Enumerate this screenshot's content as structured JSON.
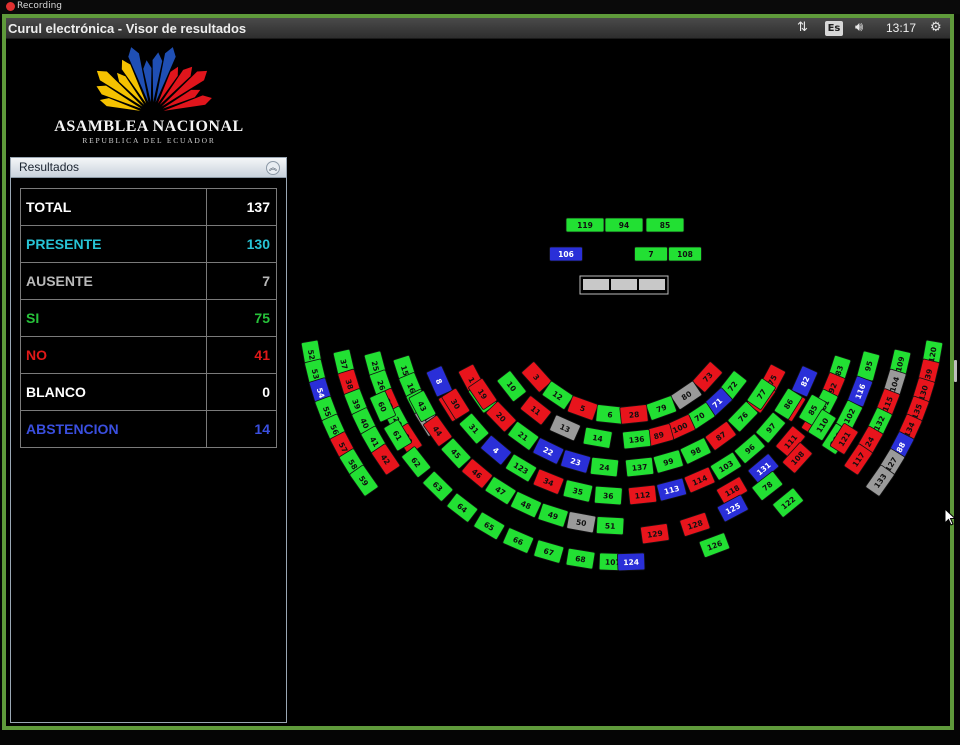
{
  "recording": {
    "label": "Recording"
  },
  "window": {
    "title": "Curul electrónica - Visor de resultados",
    "tray": {
      "network_icon": "network-arrows-icon",
      "language": "Es",
      "volume_icon": "volume-icon",
      "time": "13:17",
      "settings_icon": "gear-icon"
    }
  },
  "logo": {
    "title": "ASAMBLEA NACIONAL",
    "subtitle": "REPUBLICA DEL ECUADOR",
    "colors": {
      "yellow": "#f5c200",
      "blue": "#1f4fb4",
      "red": "#e0151c"
    }
  },
  "results": {
    "header": "Resultados",
    "rows": [
      {
        "label": "TOTAL",
        "value": "137",
        "color": "#ffffff"
      },
      {
        "label": "PRESENTE",
        "value": "130",
        "color": "#27c4d6"
      },
      {
        "label": "AUSENTE",
        "value": "7",
        "color": "#b9b9b9"
      },
      {
        "label": "SI",
        "value": "75",
        "color": "#27c23a"
      },
      {
        "label": "NO",
        "value": "41",
        "color": "#e01818"
      },
      {
        "label": "BLANCO",
        "value": "0",
        "color": "#ffffff"
      },
      {
        "label": "ABSTENCION",
        "value": "14",
        "color": "#3a4fe0"
      }
    ]
  },
  "vote_colors": {
    "si": "#22e033",
    "no": "#e8141c",
    "abstencion": "#2a2fd8",
    "ausente": "#9a9a9a"
  },
  "seats": {
    "top_rows": [
      {
        "row": 1,
        "seats": [
          {
            "n": "119",
            "v": "si"
          },
          {
            "n": "94",
            "v": "si"
          },
          {
            "n": "85",
            "v": "si"
          }
        ]
      },
      {
        "row": 2,
        "seats": [
          {
            "n": "106",
            "v": "abstencion"
          },
          {
            "n": "7",
            "v": "si"
          },
          {
            "n": "108",
            "v": "si"
          }
        ]
      }
    ],
    "presidium": [
      "",
      "",
      ""
    ],
    "left_block": [
      {
        "n": "52",
        "v": "si"
      },
      {
        "n": "53",
        "v": "si"
      },
      {
        "n": "54",
        "v": "abstencion"
      },
      {
        "n": "55",
        "v": "si"
      },
      {
        "n": "56",
        "v": "si"
      },
      {
        "n": "57",
        "v": "no"
      },
      {
        "n": "58",
        "v": "si"
      },
      {
        "n": "59",
        "v": "si"
      },
      {
        "n": "37",
        "v": "si"
      },
      {
        "n": "38",
        "v": "no"
      },
      {
        "n": "39",
        "v": "si"
      },
      {
        "n": "40",
        "v": "si"
      },
      {
        "n": "41",
        "v": "si"
      },
      {
        "n": "42",
        "v": "no"
      },
      {
        "n": "25",
        "v": "si"
      },
      {
        "n": "26",
        "v": "si"
      },
      {
        "n": "27",
        "v": "no"
      },
      {
        "n": "28",
        "v": "si"
      },
      {
        "n": "29",
        "v": "no"
      },
      {
        "n": "15",
        "v": "si"
      },
      {
        "n": "16",
        "v": "si"
      },
      {
        "n": "17",
        "v": "si"
      },
      {
        "n": "18",
        "v": "ausente"
      },
      {
        "n": "8",
        "v": "abstencion"
      },
      {
        "n": "9",
        "v": "no"
      },
      {
        "n": "1",
        "v": "no"
      },
      {
        "n": "2",
        "v": "si"
      },
      {
        "n": "3",
        "v": "no"
      },
      {
        "n": "12",
        "v": "si"
      },
      {
        "n": "5",
        "v": "no"
      },
      {
        "n": "6",
        "v": "si"
      },
      {
        "n": "10",
        "v": "si"
      },
      {
        "n": "11",
        "v": "no"
      },
      {
        "n": "13",
        "v": "ausente"
      },
      {
        "n": "14",
        "v": "si"
      },
      {
        "n": "19",
        "v": "no"
      },
      {
        "n": "20",
        "v": "no"
      },
      {
        "n": "21",
        "v": "si"
      },
      {
        "n": "22",
        "v": "abstencion"
      },
      {
        "n": "23",
        "v": "abstencion"
      },
      {
        "n": "24",
        "v": "si"
      },
      {
        "n": "30",
        "v": "no"
      },
      {
        "n": "31",
        "v": "si"
      },
      {
        "n": "4",
        "v": "abstencion"
      },
      {
        "n": "123",
        "v": "si"
      },
      {
        "n": "34",
        "v": "no"
      },
      {
        "n": "35",
        "v": "si"
      },
      {
        "n": "36",
        "v": "si"
      },
      {
        "n": "43",
        "v": "si"
      },
      {
        "n": "44",
        "v": "no"
      },
      {
        "n": "45",
        "v": "si"
      },
      {
        "n": "46",
        "v": "no"
      },
      {
        "n": "47",
        "v": "si"
      },
      {
        "n": "48",
        "v": "si"
      },
      {
        "n": "49",
        "v": "si"
      },
      {
        "n": "50",
        "v": "ausente"
      },
      {
        "n": "51",
        "v": "si"
      },
      {
        "n": "60",
        "v": "si"
      },
      {
        "n": "61",
        "v": "si"
      },
      {
        "n": "62",
        "v": "si"
      },
      {
        "n": "63",
        "v": "si"
      },
      {
        "n": "64",
        "v": "si"
      },
      {
        "n": "65",
        "v": "si"
      },
      {
        "n": "66",
        "v": "si"
      },
      {
        "n": "67",
        "v": "si"
      },
      {
        "n": "68",
        "v": "si"
      },
      {
        "n": "107",
        "v": "si"
      }
    ],
    "right_block": [
      {
        "n": "120",
        "v": "si"
      },
      {
        "n": "39",
        "v": "no"
      },
      {
        "n": "130",
        "v": "no"
      },
      {
        "n": "135",
        "v": "no"
      },
      {
        "n": "134",
        "v": "no"
      },
      {
        "n": "88",
        "v": "abstencion"
      },
      {
        "n": "127",
        "v": "ausente"
      },
      {
        "n": "133",
        "v": "ausente"
      },
      {
        "n": "109",
        "v": "si"
      },
      {
        "n": "104",
        "v": "ausente"
      },
      {
        "n": "115",
        "v": "no"
      },
      {
        "n": "132",
        "v": "si"
      },
      {
        "n": "24",
        "v": "no"
      },
      {
        "n": "117",
        "v": "no"
      },
      {
        "n": "95",
        "v": "si"
      },
      {
        "n": "116",
        "v": "abstencion"
      },
      {
        "n": "102",
        "v": "si"
      },
      {
        "n": "101",
        "v": "si"
      },
      {
        "n": "83",
        "v": "si"
      },
      {
        "n": "92",
        "v": "no"
      },
      {
        "n": "81",
        "v": "si"
      },
      {
        "n": "90",
        "v": "no"
      },
      {
        "n": "82",
        "v": "abstencion"
      },
      {
        "n": "81",
        "v": "no"
      },
      {
        "n": "75",
        "v": "no"
      },
      {
        "n": "74",
        "v": "no"
      },
      {
        "n": "73",
        "v": "no"
      },
      {
        "n": "80",
        "v": "ausente"
      },
      {
        "n": "79",
        "v": "si"
      },
      {
        "n": "28",
        "v": "no"
      },
      {
        "n": "72",
        "v": "si"
      },
      {
        "n": "71",
        "v": "abstencion"
      },
      {
        "n": "70",
        "v": "si"
      },
      {
        "n": "100",
        "v": "no"
      },
      {
        "n": "89",
        "v": "no"
      },
      {
        "n": "136",
        "v": "si"
      },
      {
        "n": "77",
        "v": "si"
      },
      {
        "n": "76",
        "v": "si"
      },
      {
        "n": "87",
        "v": "no"
      },
      {
        "n": "98",
        "v": "si"
      },
      {
        "n": "99",
        "v": "si"
      },
      {
        "n": "137",
        "v": "si"
      },
      {
        "n": "86",
        "v": "si"
      },
      {
        "n": "97",
        "v": "si"
      },
      {
        "n": "96",
        "v": "si"
      },
      {
        "n": "103",
        "v": "si"
      },
      {
        "n": "114",
        "v": "no"
      },
      {
        "n": "113",
        "v": "abstencion"
      },
      {
        "n": "112",
        "v": "no"
      },
      {
        "n": "85",
        "v": "si"
      },
      {
        "n": "111",
        "v": "no"
      },
      {
        "n": "131",
        "v": "abstencion"
      },
      {
        "n": "118",
        "v": "no"
      },
      {
        "n": "110",
        "v": "si"
      },
      {
        "n": "108",
        "v": "no"
      },
      {
        "n": "78",
        "v": "si"
      },
      {
        "n": "125",
        "v": "abstencion"
      },
      {
        "n": "128",
        "v": "no"
      },
      {
        "n": "129",
        "v": "no"
      },
      {
        "n": "121",
        "v": "no"
      },
      {
        "n": "122",
        "v": "si"
      },
      {
        "n": "126",
        "v": "si"
      },
      {
        "n": "124",
        "v": "abstencion"
      }
    ]
  }
}
